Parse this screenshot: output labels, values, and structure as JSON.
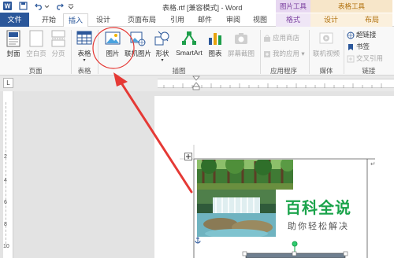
{
  "window": {
    "title": "表格.rtf [兼容模式] - Word"
  },
  "context_groups": {
    "picture_tools": "图片工具",
    "table_tools": "表格工具"
  },
  "tabs": {
    "file": "文件",
    "home": "开始",
    "insert": "插入",
    "design": "设计",
    "layout": "页面布局",
    "references": "引用",
    "mailings": "邮件",
    "review": "审阅",
    "view": "视图",
    "format": "格式",
    "table_design": "设计",
    "table_layout": "布局"
  },
  "ribbon": {
    "pages": {
      "cover": "封面",
      "blank": "空白页",
      "break": "分页",
      "label": "页面"
    },
    "tables": {
      "table": "表格",
      "label": "表格"
    },
    "illustrations": {
      "picture": "图片",
      "online_picture": "联机图片",
      "shapes": "形状",
      "smartart": "SmartArt",
      "chart": "图表",
      "screenshot": "屏幕截图",
      "label": "插图"
    },
    "apps": {
      "store": "应用商店",
      "my_apps": "我的应用",
      "label": "应用程序"
    },
    "media": {
      "online_video": "联机视频",
      "label": "媒体"
    },
    "links": {
      "hyperlink": "超链接",
      "bookmark": "书签",
      "cross_ref": "交叉引用",
      "label": "链接"
    }
  },
  "ruler": {
    "corner": "L",
    "vertical_marks": [
      "2",
      "4",
      "6",
      "8",
      "10"
    ]
  },
  "watermark": {
    "title": "百科全说",
    "subtitle": "助你轻松解决"
  },
  "colors": {
    "file_tab": "#2b579a",
    "annotation": "#e53935",
    "watermark_green": "#1aa34a"
  }
}
